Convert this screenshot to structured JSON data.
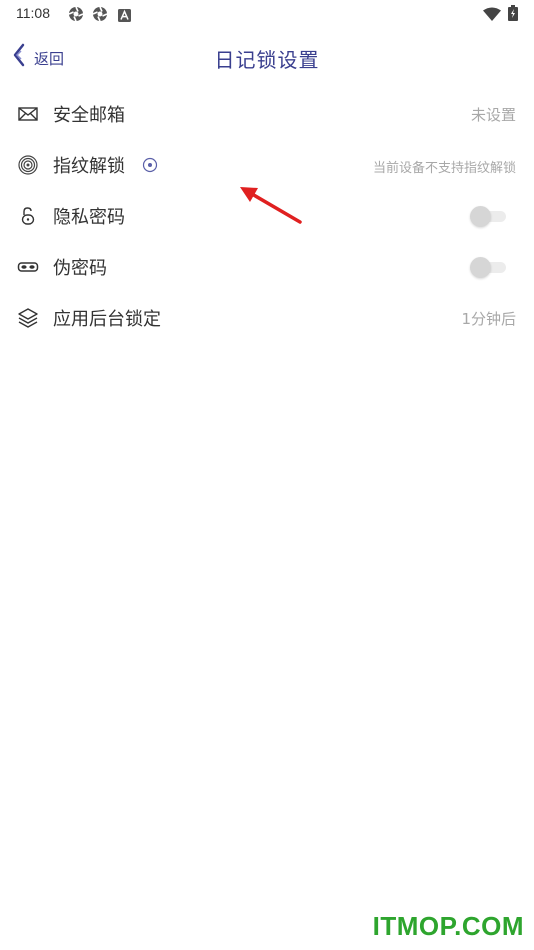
{
  "status_bar": {
    "time": "11:08",
    "icons": [
      "app-notification-icon",
      "app-notification-icon",
      "a-letter-icon",
      "wifi-icon",
      "battery-icon"
    ]
  },
  "header": {
    "back_label": "返回",
    "title": "日记锁设置",
    "accent_color": "#3a3f8f"
  },
  "settings": [
    {
      "icon": "envelope-icon",
      "label": "安全邮箱",
      "value": "未设置"
    },
    {
      "icon": "fingerprint-icon",
      "label": "指纹解锁",
      "value": "当前设备不支持指纹解锁",
      "has_info_icon": true
    },
    {
      "icon": "unlock-icon",
      "label": "隐私密码",
      "toggle_on": false
    },
    {
      "icon": "mask-icon",
      "label": "伪密码",
      "toggle_on": false
    },
    {
      "icon": "layers-icon",
      "label": "应用后台锁定",
      "value": "1分钟后"
    }
  ],
  "annotation": {
    "type": "red-arrow",
    "color": "#e02020"
  },
  "watermark": "ITMOP.COM",
  "watermark_color": "#2ea52e"
}
